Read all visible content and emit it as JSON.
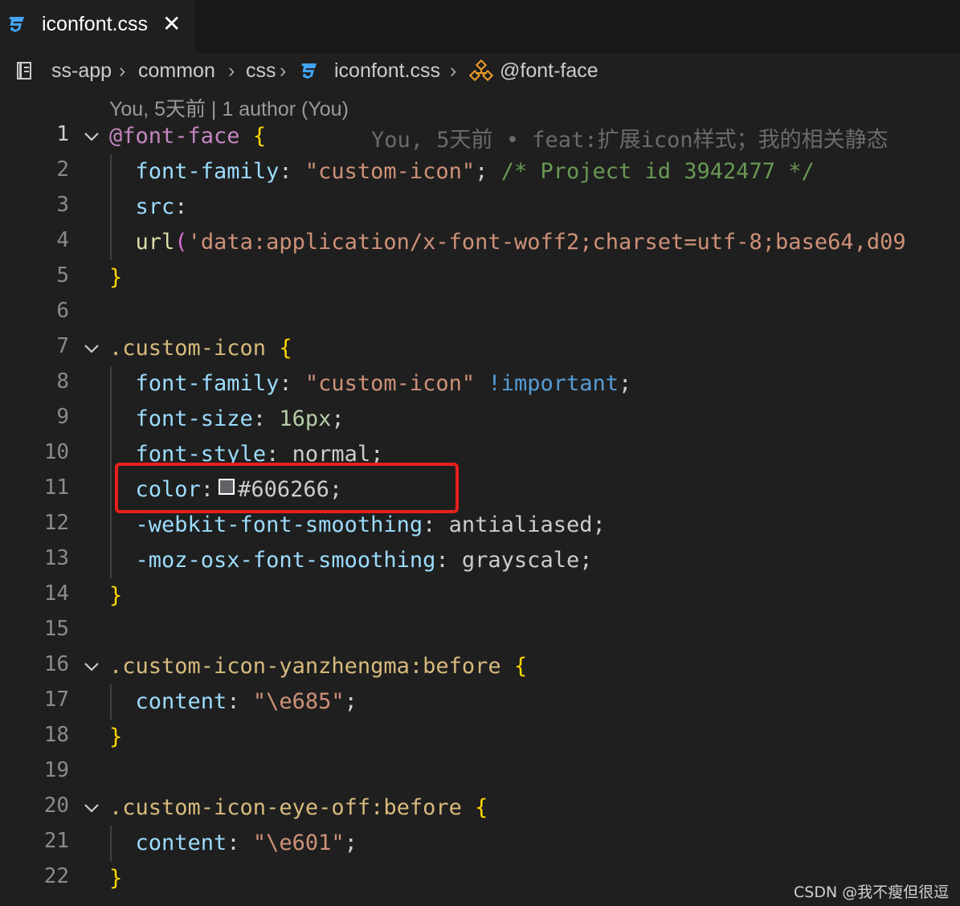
{
  "tab": {
    "label": "iconfont.css",
    "close_glyph": "✕",
    "icon": "css3-icon"
  },
  "breadcrumb": {
    "icon": "book-icon",
    "items": [
      "ss-app",
      "common",
      "css",
      "iconfont.css",
      "@font-face"
    ],
    "file_icon": "css3-icon",
    "symbol_icon": "symbol-structure-icon"
  },
  "blame": {
    "header": "You, 5天前 | 1 author (You)",
    "inline": "You, 5天前 • feat:扩展icon样式；我的相关静态"
  },
  "lines": {
    "l1": {
      "n": "1",
      "t1": "@font-face",
      "t2": " {"
    },
    "l2": {
      "n": "2",
      "t1": "font-family",
      "t2": ": ",
      "t3": "\"custom-icon\"",
      "t4": "; ",
      "t5": "/* Project id 3942477 */"
    },
    "l3": {
      "n": "3",
      "t1": "src",
      "t2": ":"
    },
    "l4": {
      "n": "4",
      "t1": "url",
      "t2": "(",
      "t3": "'data:application/x-font-woff2;charset=utf-8;base64,d09"
    },
    "l5": {
      "n": "5",
      "t1": "}"
    },
    "l6": {
      "n": "6"
    },
    "l7": {
      "n": "7",
      "t1": ".custom-icon",
      "t2": " {"
    },
    "l8": {
      "n": "8",
      "t1": "font-family",
      "t2": ": ",
      "t3": "\"custom-icon\"",
      "t4": " !important",
      "t5": ";"
    },
    "l9": {
      "n": "9",
      "t1": "font-size",
      "t2": ": ",
      "t3": "16px",
      "t4": ";"
    },
    "l10": {
      "n": "10",
      "t1": "font-style",
      "t2": ": ",
      "t3": "normal",
      "t4": ";"
    },
    "l11": {
      "n": "11",
      "t1": "color",
      "t2": ":",
      "t3": "#606266",
      "t4": ";"
    },
    "l12": {
      "n": "12",
      "t1": "-webkit-font-smoothing",
      "t2": ": ",
      "t3": "antialiased",
      "t4": ";"
    },
    "l13": {
      "n": "13",
      "t1": "-moz-osx-font-smoothing",
      "t2": ": ",
      "t3": "grayscale",
      "t4": ";"
    },
    "l14": {
      "n": "14",
      "t1": "}"
    },
    "l15": {
      "n": "15"
    },
    "l16": {
      "n": "16",
      "t1": ".custom-icon-yanzhengma:before",
      "t2": " {"
    },
    "l17": {
      "n": "17",
      "t1": "content",
      "t2": ": ",
      "t3": "\"\\e685\"",
      "t4": ";"
    },
    "l18": {
      "n": "18",
      "t1": "}"
    },
    "l19": {
      "n": "19"
    },
    "l20": {
      "n": "20",
      "t1": ".custom-icon-eye-off:before",
      "t2": " {"
    },
    "l21": {
      "n": "21",
      "t1": "content",
      "t2": ": ",
      "t3": "\"\\e601\"",
      "t4": ";"
    },
    "l22": {
      "n": "22",
      "t1": "}"
    }
  },
  "colors": {
    "swatch": "#606266",
    "highlight_border": "#e8201c"
  },
  "watermark": "CSDN @我不瘦但很逗"
}
